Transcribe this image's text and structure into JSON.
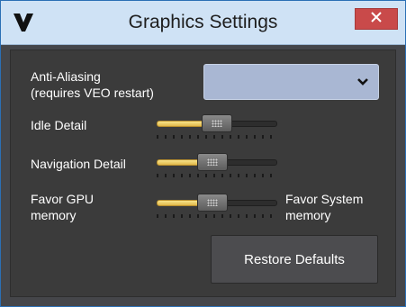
{
  "window": {
    "title": "Graphics Settings",
    "app_icon": "veo-logo-icon",
    "close_icon": "close-icon",
    "colors": {
      "titlebar": "#cfe2f5",
      "close": "#c94a4a",
      "panel": "#3b3b3b",
      "accent": "#e2b94b"
    }
  },
  "settings": {
    "anti_aliasing": {
      "label_line1": "Anti-Aliasing",
      "label_line2": "(requires VEO restart)",
      "selected_value": "",
      "chevron_icon": "chevron-down-icon"
    },
    "idle_detail": {
      "label": "Idle Detail",
      "value": 0.5
    },
    "navigation_detail": {
      "label": "Navigation Detail",
      "value": 0.45
    },
    "gpu_balance": {
      "left_label_line1": "Favor GPU",
      "left_label_line2": "memory",
      "right_label_line1": "Favor System",
      "right_label_line2": "memory",
      "value": 0.45
    }
  },
  "actions": {
    "restore_defaults_label": "Restore Defaults"
  }
}
